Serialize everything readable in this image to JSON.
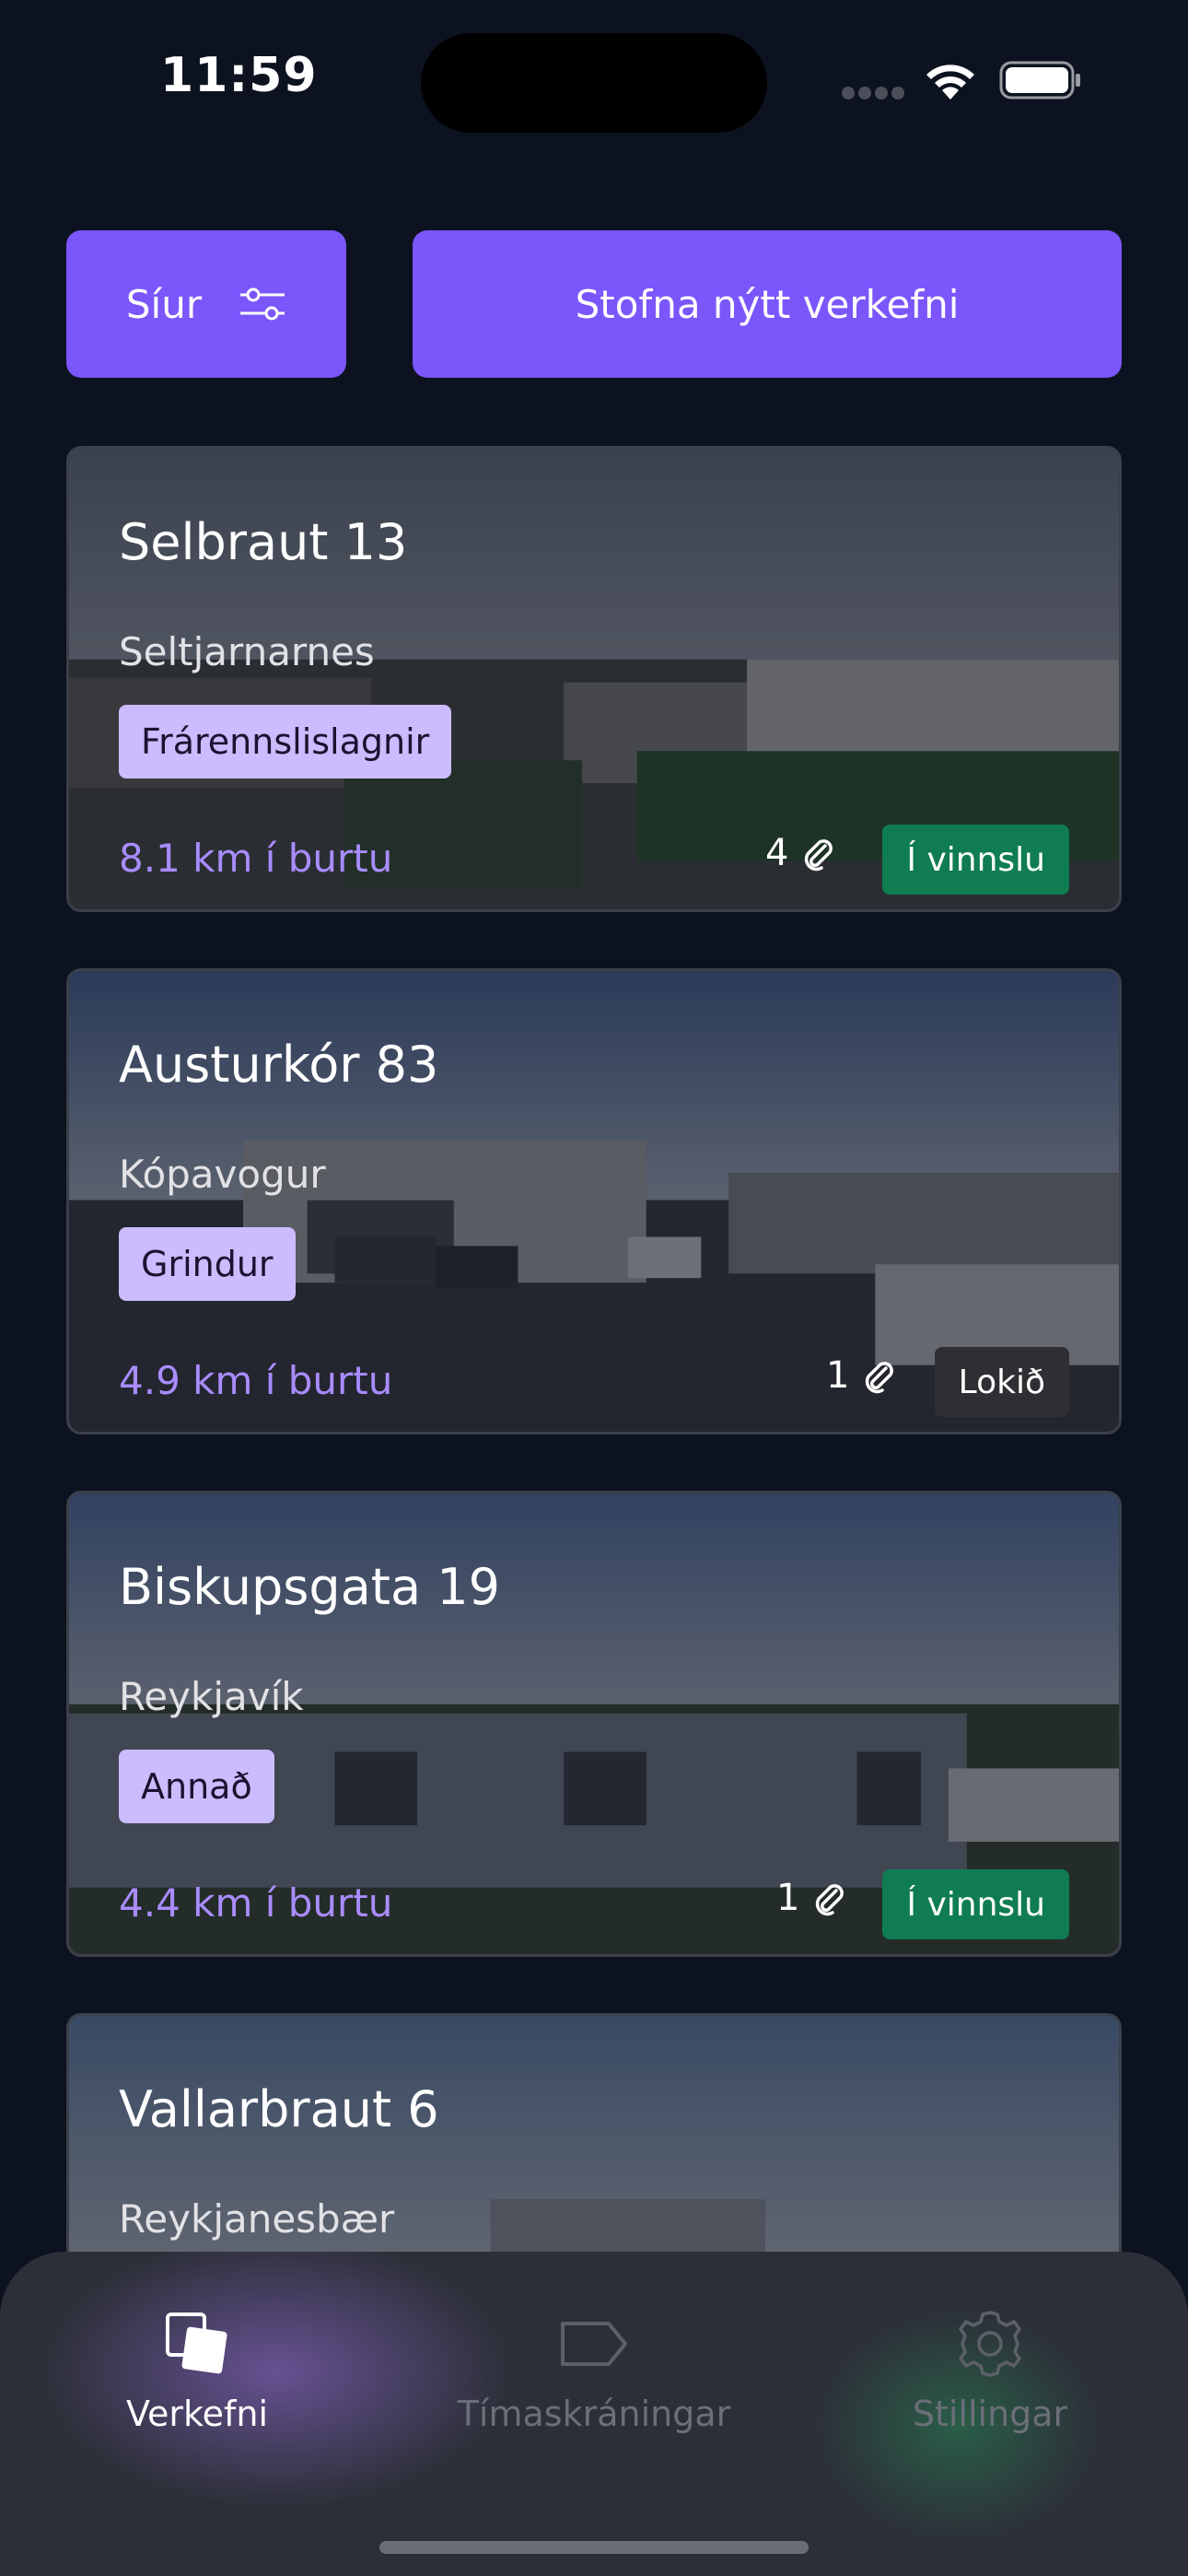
{
  "status_bar": {
    "time": "11:59"
  },
  "toolbar": {
    "filter_label": "Síur",
    "new_project_label": "Stofna nýtt verkefni"
  },
  "projects": [
    {
      "title": "Selbraut 13",
      "city": "Seltjarnarnes",
      "category": "Frárennslislagnir",
      "distance": "8.1 km í burtu",
      "attachments": "4",
      "status": "Í vinnslu"
    },
    {
      "title": "Austurkór 83",
      "city": "Kópavogur",
      "category": "Grindur",
      "distance": "4.9 km í burtu",
      "attachments": "1",
      "status": "Lokið"
    },
    {
      "title": "Biskupsgata 19",
      "city": "Reykjavík",
      "category": "Annað",
      "distance": "4.4 km í burtu",
      "attachments": "1",
      "status": "Í vinnslu"
    },
    {
      "title": "Vallarbraut 6",
      "city": "Reykjanesbær"
    }
  ],
  "tabs": [
    {
      "label": "Verkefni",
      "icon": "projects-icon",
      "active": true
    },
    {
      "label": "Tímaskráningar",
      "icon": "tag-icon",
      "active": false
    },
    {
      "label": "Stillingar",
      "icon": "gear-icon",
      "active": false
    }
  ],
  "colors": {
    "accent": "#7b56fb",
    "tag_background": "#cbbcff",
    "distance_text": "#a98cff",
    "status_in_progress": "#0f7c52",
    "status_done": "#2f2f33",
    "background": "#0d1220"
  }
}
